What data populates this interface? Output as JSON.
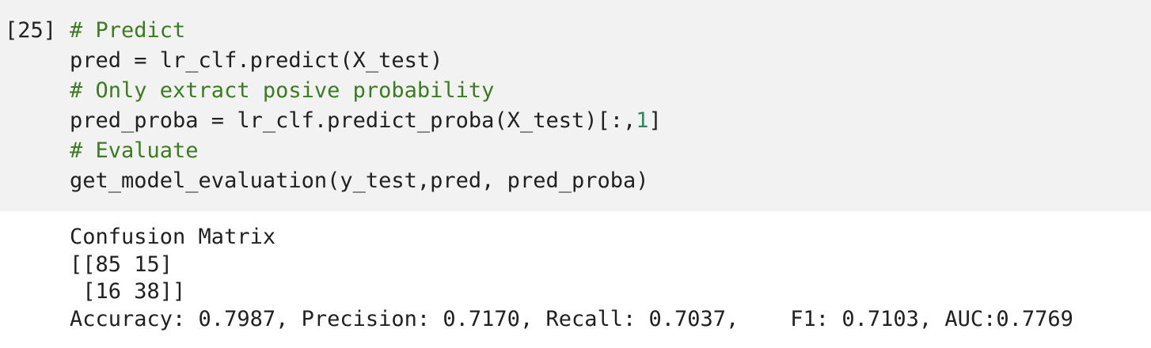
{
  "cell": {
    "prompt": "[25]",
    "code_lines": [
      [
        {
          "text": "# Predict",
          "kind": "comment"
        }
      ],
      [
        {
          "text": "pred = lr_clf.predict(X_test)",
          "kind": "code"
        }
      ],
      [
        {
          "text": "# Only extract posive probability",
          "kind": "comment"
        }
      ],
      [
        {
          "text": "pred_proba = lr_clf.predict_proba(X_test)[:,",
          "kind": "code"
        },
        {
          "text": "1",
          "kind": "number"
        },
        {
          "text": "]",
          "kind": "code"
        }
      ],
      [
        {
          "text": "# Evaluate",
          "kind": "comment"
        }
      ],
      [
        {
          "text": "get_model_evaluation(y_test,pred, pred_proba)",
          "kind": "code"
        }
      ]
    ],
    "output_lines": [
      "Confusion Matrix",
      "[[85 15]",
      " [16 38]]",
      "Accuracy: 0.7987, Precision: 0.7170, Recall: 0.7037,    F1: 0.7103, AUC:0.7769"
    ]
  },
  "colors": {
    "input_background": "#f2f2f2",
    "comment": "#3a7d1e",
    "number": "#2a8a5a",
    "text": "#212121"
  }
}
